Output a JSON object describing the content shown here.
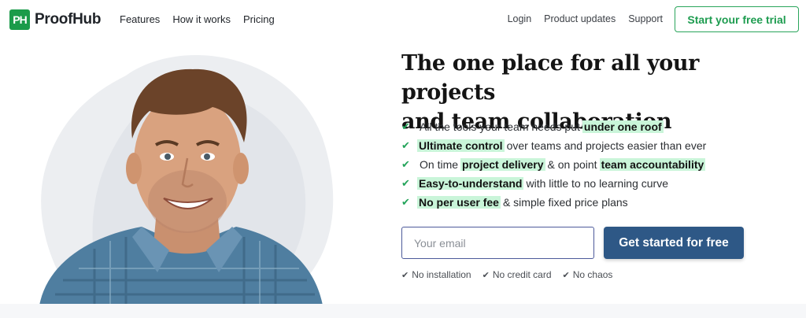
{
  "brand": {
    "logo_mark": "PH",
    "name": "ProofHub",
    "color": "#1b9b4a"
  },
  "nav_left": [
    "Features",
    "How it works",
    "Pricing"
  ],
  "nav_right": [
    "Login",
    "Product updates",
    "Support"
  ],
  "header_cta": "Start your free trial",
  "hero": {
    "title_line1": "The one place for all your projects",
    "title_line2": "and team collaboration",
    "features": [
      [
        {
          "t": "All the tools your team needs put",
          "h": false
        },
        {
          "t": "under one roof",
          "h": true
        }
      ],
      [
        {
          "t": "Ultimate control",
          "h": true
        },
        {
          "t": "over teams and projects easier than ever",
          "h": false
        }
      ],
      [
        {
          "t": "On time",
          "h": false
        },
        {
          "t": "project delivery",
          "h": true
        },
        {
          "t": "& on point",
          "h": false
        },
        {
          "t": "team accountability",
          "h": true
        }
      ],
      [
        {
          "t": "Easy-to-understand",
          "h": true
        },
        {
          "t": "with little to no learning curve",
          "h": false
        }
      ],
      [
        {
          "t": "No per user fee",
          "h": true
        },
        {
          "t": "& simple fixed price plans",
          "h": false
        }
      ]
    ],
    "email_placeholder": "Your email",
    "cta_label": "Get started for free",
    "perks": [
      "No installation",
      "No credit card",
      "No chaos"
    ]
  },
  "icons": {
    "check": "check-icon",
    "avatar": "person-photo"
  },
  "colors": {
    "accent_green": "#23a45a",
    "highlight": "#c9f5d9",
    "cta_blue": "#2e5886"
  }
}
